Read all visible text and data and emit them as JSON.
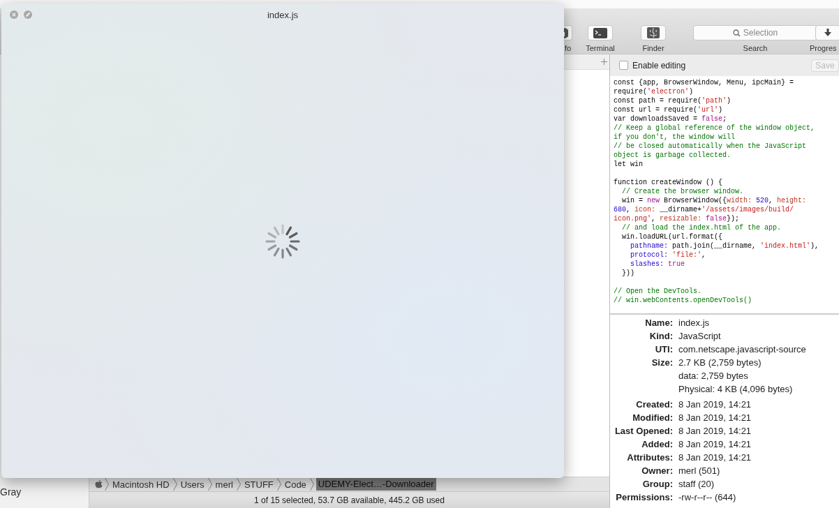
{
  "quicklook": {
    "title": "index.js"
  },
  "toolbar": [
    {
      "kind": "button",
      "label": "fo"
    },
    {
      "kind": "button",
      "label": "Terminal"
    },
    {
      "kind": "button",
      "label": "Finder"
    },
    {
      "kind": "search",
      "placeholder": "Selection",
      "label": "Search"
    },
    {
      "kind": "button",
      "label": "Progres"
    }
  ],
  "sidebar": {
    "items": [
      {
        "label": "Gray"
      }
    ]
  },
  "path_bar": [
    {
      "label": "Macintosh HD",
      "selected": false
    },
    {
      "label": "Users",
      "selected": false
    },
    {
      "label": "merl",
      "selected": false
    },
    {
      "label": "STUFF",
      "selected": false
    },
    {
      "label": "Code",
      "selected": false
    },
    {
      "label": "UDEMY-Elect…-Downloader",
      "selected": true
    }
  ],
  "status_bar": "1 of 15 selected, 53.7 GB available, 445.2 GB used",
  "preview": {
    "enable_editing": {
      "label": "Enable editing",
      "checked": false
    },
    "save": {
      "label": "Save",
      "disabled": true
    },
    "code": [
      {
        "kind": "code",
        "segments": [
          {
            "t": "const {app, BrowserWindow, Menu, ipcMain} =",
            "kind": "plain"
          }
        ]
      },
      {
        "kind": "code",
        "segments": [
          {
            "t": "require(",
            "kind": "plain"
          },
          {
            "t": "'electron'",
            "kind": "string"
          },
          {
            "t": ")",
            "kind": "plain"
          }
        ]
      },
      {
        "kind": "code",
        "segments": [
          {
            "t": "const path = require(",
            "kind": "plain"
          },
          {
            "t": "'path'",
            "kind": "string"
          },
          {
            "t": ")",
            "kind": "plain"
          }
        ]
      },
      {
        "kind": "code",
        "segments": [
          {
            "t": "const url = require(",
            "kind": "plain"
          },
          {
            "t": "'url'",
            "kind": "string"
          },
          {
            "t": ")",
            "kind": "plain"
          }
        ]
      },
      {
        "kind": "code",
        "segments": [
          {
            "t": "var downloadsSaved = ",
            "kind": "plain"
          },
          {
            "t": "false",
            "kind": "keyword"
          },
          {
            "t": ";",
            "kind": "plain"
          }
        ]
      },
      {
        "kind": "code",
        "segments": [
          {
            "t": "// Keep a global reference of the window object,",
            "kind": "comment"
          }
        ]
      },
      {
        "kind": "code",
        "segments": [
          {
            "t": "if you don't, the window will",
            "kind": "comment"
          }
        ]
      },
      {
        "kind": "code",
        "segments": [
          {
            "t": "// be closed automatically when the JavaScript",
            "kind": "comment"
          }
        ]
      },
      {
        "kind": "code",
        "segments": [
          {
            "t": "object is garbage collected.",
            "kind": "comment"
          }
        ]
      },
      {
        "kind": "code",
        "segments": [
          {
            "t": "let win",
            "kind": "plain"
          }
        ]
      },
      {
        "kind": "blank"
      },
      {
        "kind": "code",
        "segments": [
          {
            "t": "function createWindow () {",
            "kind": "plain"
          }
        ]
      },
      {
        "kind": "code",
        "segments": [
          {
            "t": "  // Create the browser window.",
            "kind": "comment"
          }
        ]
      },
      {
        "kind": "code",
        "segments": [
          {
            "t": "  win = ",
            "kind": "plain"
          },
          {
            "t": "new",
            "kind": "keyword"
          },
          {
            "t": " BrowserWindow({",
            "kind": "plain"
          },
          {
            "t": "width:",
            "kind": "attribute"
          },
          {
            "t": " 520",
            "kind": "number"
          },
          {
            "t": ", ",
            "kind": "plain"
          },
          {
            "t": "height:",
            "kind": "attribute"
          }
        ]
      },
      {
        "kind": "code",
        "segments": [
          {
            "t": "680",
            "kind": "number"
          },
          {
            "t": ", ",
            "kind": "plain"
          },
          {
            "t": "icon:",
            "kind": "attribute"
          },
          {
            "t": " __dirname+",
            "kind": "plain"
          },
          {
            "t": "'/assets/images/build/",
            "kind": "string"
          }
        ]
      },
      {
        "kind": "code",
        "segments": [
          {
            "t": "icon.png'",
            "kind": "string"
          },
          {
            "t": ", ",
            "kind": "plain"
          },
          {
            "t": "resizable:",
            "kind": "attribute"
          },
          {
            "t": " false",
            "kind": "keyword"
          },
          {
            "t": "});",
            "kind": "plain"
          }
        ]
      },
      {
        "kind": "code",
        "segments": [
          {
            "t": "  // and load the index.html of the app.",
            "kind": "comment"
          }
        ]
      },
      {
        "kind": "code",
        "segments": [
          {
            "t": "  win.loadURL(url.format({",
            "kind": "plain"
          }
        ]
      },
      {
        "kind": "code",
        "segments": [
          {
            "t": "    pathname:",
            "kind": "property"
          },
          {
            "t": " path.join(__dirname, ",
            "kind": "plain"
          },
          {
            "t": "'index.html'",
            "kind": "string"
          },
          {
            "t": "),",
            "kind": "plain"
          }
        ]
      },
      {
        "kind": "code",
        "segments": [
          {
            "t": "    protocol:",
            "kind": "property"
          },
          {
            "t": " 'file:'",
            "kind": "string"
          },
          {
            "t": ",",
            "kind": "plain"
          }
        ]
      },
      {
        "kind": "code",
        "segments": [
          {
            "t": "    slashes:",
            "kind": "property"
          },
          {
            "t": " true",
            "kind": "keyword"
          }
        ]
      },
      {
        "kind": "code",
        "segments": [
          {
            "t": "  }))",
            "kind": "plain"
          }
        ]
      },
      {
        "kind": "blank"
      },
      {
        "kind": "code",
        "segments": [
          {
            "t": "// Open the DevTools.",
            "kind": "comment"
          }
        ]
      },
      {
        "kind": "code",
        "segments": [
          {
            "t": "// win.webContents.openDevTools()",
            "kind": "comment"
          }
        ]
      }
    ],
    "info": [
      {
        "label": "Name:",
        "values": [
          "index.js"
        ]
      },
      {
        "label": "Kind:",
        "values": [
          "JavaScript"
        ]
      },
      {
        "label": "UTI:",
        "values": [
          "com.netscape.javascript-source"
        ]
      },
      {
        "label": "Size:",
        "values": [
          "2.7 KB (2,759 bytes)",
          "data: 2,759 bytes",
          "Physical: 4 KB (4,096 bytes)"
        ]
      },
      {
        "label": "Created:",
        "values": [
          "8 Jan 2019, 14:21"
        ]
      },
      {
        "label": "Modified:",
        "values": [
          "8 Jan 2019, 14:21"
        ]
      },
      {
        "label": "Last Opened:",
        "values": [
          "8 Jan 2019, 14:21"
        ]
      },
      {
        "label": "Added:",
        "values": [
          "8 Jan 2019, 14:21"
        ]
      },
      {
        "label": "Attributes:",
        "values": [
          "8 Jan 2019, 14:21"
        ]
      },
      {
        "label": "Owner:",
        "values": [
          "merl (501)"
        ]
      },
      {
        "label": "Group:",
        "values": [
          "staff (20)"
        ]
      },
      {
        "label": "Permissions:",
        "values": [
          "-rw-r--r-- (644)"
        ]
      }
    ]
  }
}
